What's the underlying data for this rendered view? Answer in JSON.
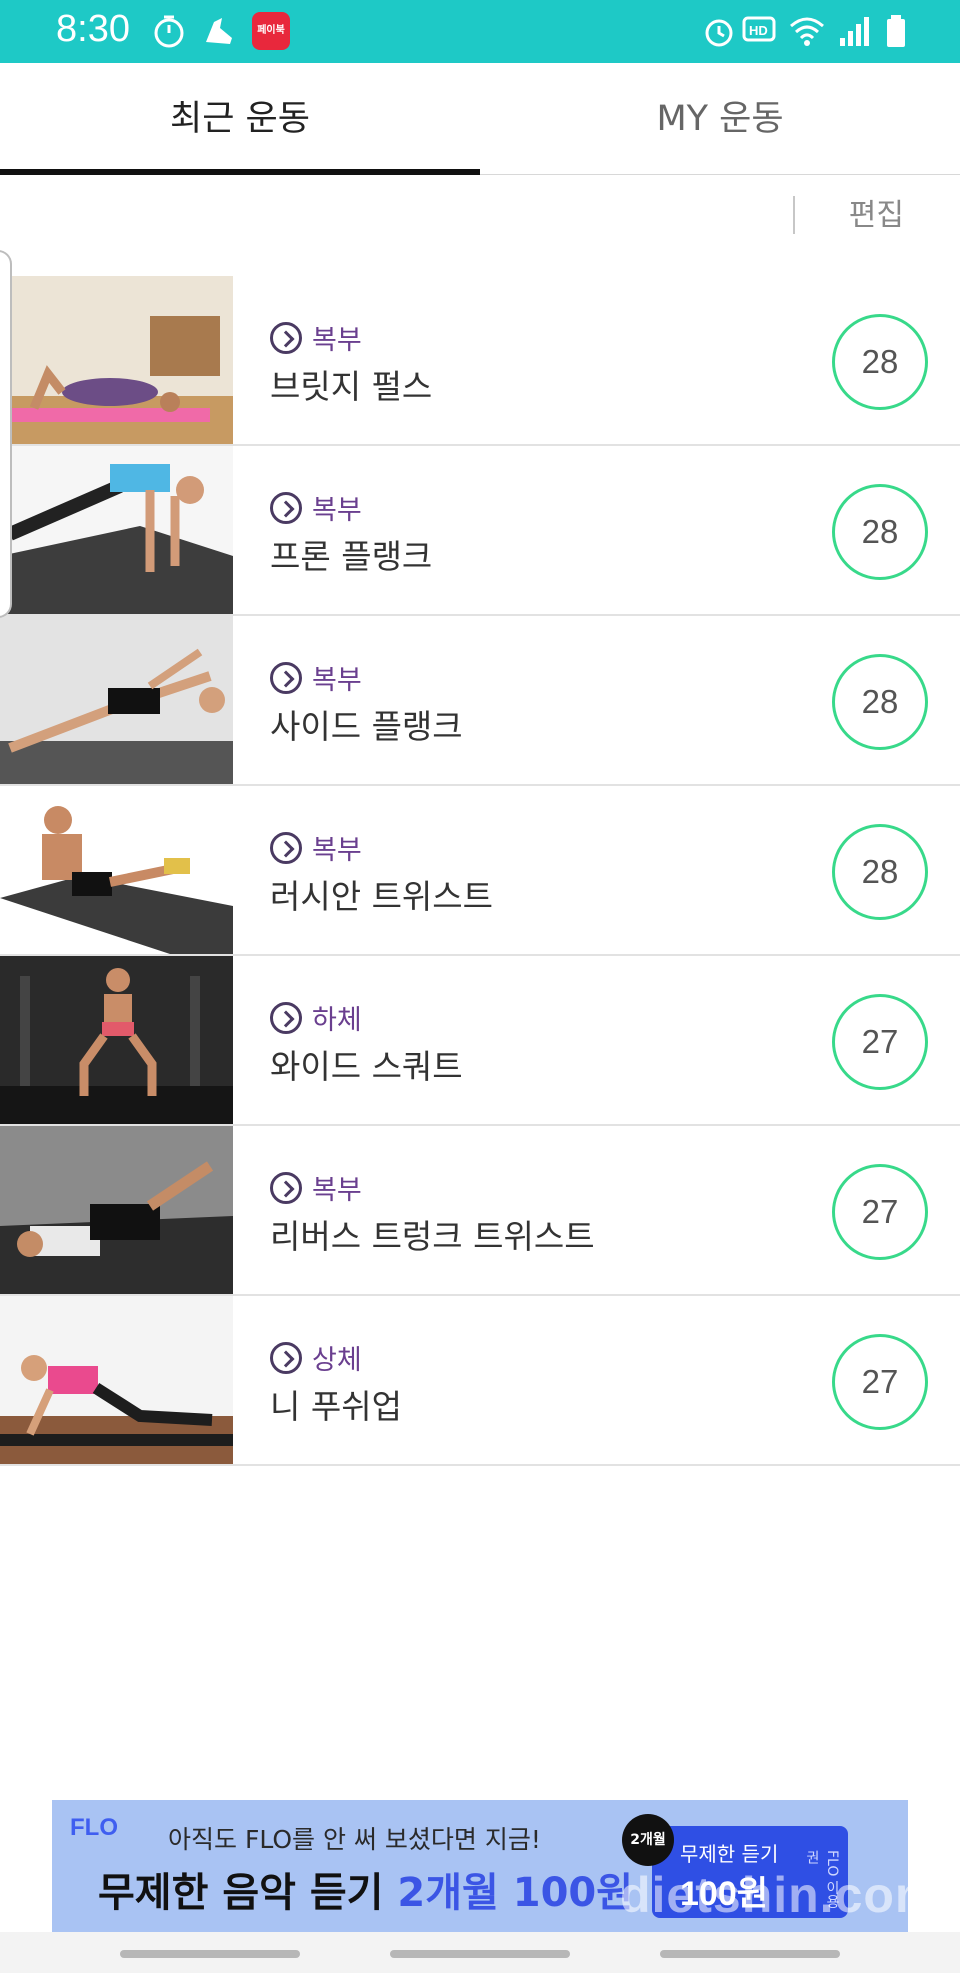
{
  "status_bar": {
    "time": "8:30",
    "left_icons": [
      "timer-icon",
      "shoe-icon"
    ],
    "app_badge": "페이북",
    "right_icons": [
      "alarm-icon",
      "hd-voice-icon",
      "wifi-icon",
      "signal-icon",
      "battery-icon"
    ],
    "color": "#1ec9c6"
  },
  "tabs": [
    {
      "label": "최근 운동",
      "active": true
    },
    {
      "label": "MY 운동",
      "active": false
    }
  ],
  "toolbar": {
    "edit_label": "편집"
  },
  "workouts": [
    {
      "category": "복부",
      "name": "브릿지 펄스",
      "count": "28"
    },
    {
      "category": "복부",
      "name": "프론 플랭크",
      "count": "28"
    },
    {
      "category": "복부",
      "name": "사이드 플랭크",
      "count": "28"
    },
    {
      "category": "복부",
      "name": "러시안 트위스트",
      "count": "28"
    },
    {
      "category": "하체",
      "name": "와이드 스쿼트",
      "count": "27"
    },
    {
      "category": "복부",
      "name": "리버스 트렁크 트위스트",
      "count": "27"
    },
    {
      "category": "상체",
      "name": "니 푸쉬업",
      "count": "27"
    }
  ],
  "ad": {
    "logo": "FLO",
    "line1": "아직도 FLO를 안 써 보셨다면 지금!",
    "line2_prefix": "무제한 음악 듣기 ",
    "line2_highlight": "2개월 100원",
    "badge": "2개월",
    "ticket_title": "무제한 듣기",
    "ticket_price": "100원",
    "ticket_side": "FLO 이용권",
    "watermark": "dietshin.com"
  },
  "colors": {
    "accent_ring": "#38d98a",
    "category": "#6a3f8f"
  }
}
